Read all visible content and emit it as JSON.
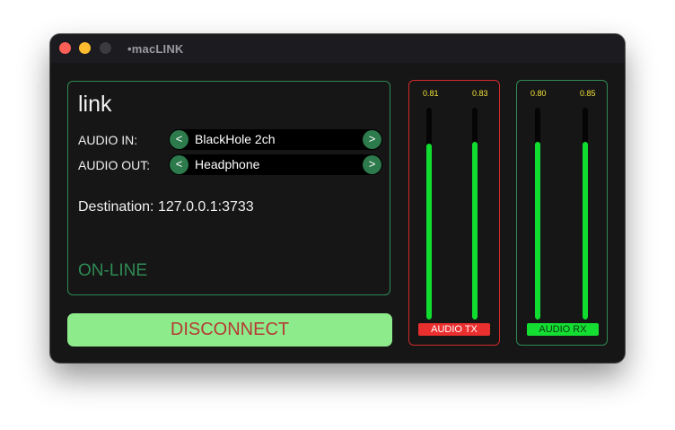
{
  "window": {
    "title": "•macLINK",
    "controls": [
      "close",
      "minimize",
      "zoom"
    ]
  },
  "link_panel": {
    "title": "link",
    "audio_in": {
      "label": "AUDIO IN:",
      "prev": "<",
      "value": "BlackHole 2ch",
      "next": ">"
    },
    "audio_out": {
      "label": "AUDIO OUT:",
      "prev": "<",
      "value": "Headphone",
      "next": ">"
    },
    "destination": "Destination: 127.0.0.1:3733",
    "status": "ON-LINE",
    "status_color": "#2f8a55"
  },
  "disconnect_button": {
    "label": "DISCONNECT",
    "background": "#8deb8b",
    "text_color": "#b63a34"
  },
  "meters": {
    "tx": {
      "label": "AUDIO TX",
      "border_color": "#d12a2a",
      "left": {
        "value": "0.81",
        "level": 0.83
      },
      "right": {
        "value": "0.83",
        "level": 0.84
      }
    },
    "rx": {
      "label": "AUDIO RX",
      "border_color": "#2f8a55",
      "left": {
        "value": "0.80",
        "level": 0.84
      },
      "right": {
        "value": "0.85",
        "level": 0.84
      }
    },
    "fill_color": "#10dd2f"
  }
}
